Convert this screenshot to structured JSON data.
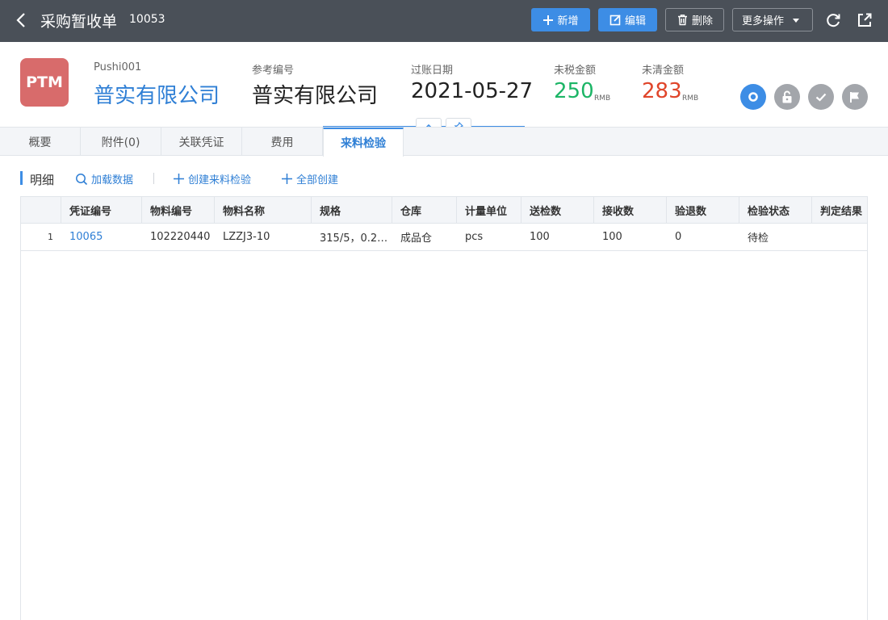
{
  "topbar": {
    "title": "采购暂收单",
    "doc_no": "10053",
    "buttons": {
      "new": "新增",
      "edit": "编辑",
      "delete": "删除",
      "more": "更多操作"
    }
  },
  "header": {
    "logo_text": "PTM",
    "fields": [
      {
        "label": "Pushi001",
        "value": "普实有限公司"
      },
      {
        "label": "参考编号",
        "value": "普实有限公司"
      },
      {
        "label": "过账日期",
        "value": "2021-05-27"
      },
      {
        "label": "未税金额",
        "value": "250",
        "unit": "RMB"
      },
      {
        "label": "未清金额",
        "value": "283",
        "unit": "RMB"
      }
    ]
  },
  "tabs": [
    "概要",
    "附件(0)",
    "关联凭证",
    "费用",
    "来料检验"
  ],
  "active_tab": "来料检验",
  "section": {
    "title": "明细",
    "tools": [
      "加载数据",
      "创建来料检验",
      "全部创建"
    ]
  },
  "table": {
    "columns": [
      "凭证编号",
      "物料编号",
      "物料名称",
      "规格",
      "仓库",
      "计量单位",
      "送检数",
      "接收数",
      "验退数",
      "检验状态",
      "判定结果"
    ],
    "rows": [
      {
        "index": "1",
        "voucher_no": "10065",
        "material_no": "102220440",
        "material_name": "LZZJ3-10",
        "spec": "315/5，0.2…",
        "warehouse": "成品仓",
        "uom": "pcs",
        "sent_qty": "100",
        "received_qty": "100",
        "returned_qty": "0",
        "status": "待检",
        "result": ""
      }
    ]
  },
  "colors": {
    "topbar": "#4a5058",
    "primary": "#3d8de5",
    "link": "#2f7fd5",
    "green": "#1cb566",
    "red": "#e0452a",
    "logo": "#d86b6b"
  }
}
